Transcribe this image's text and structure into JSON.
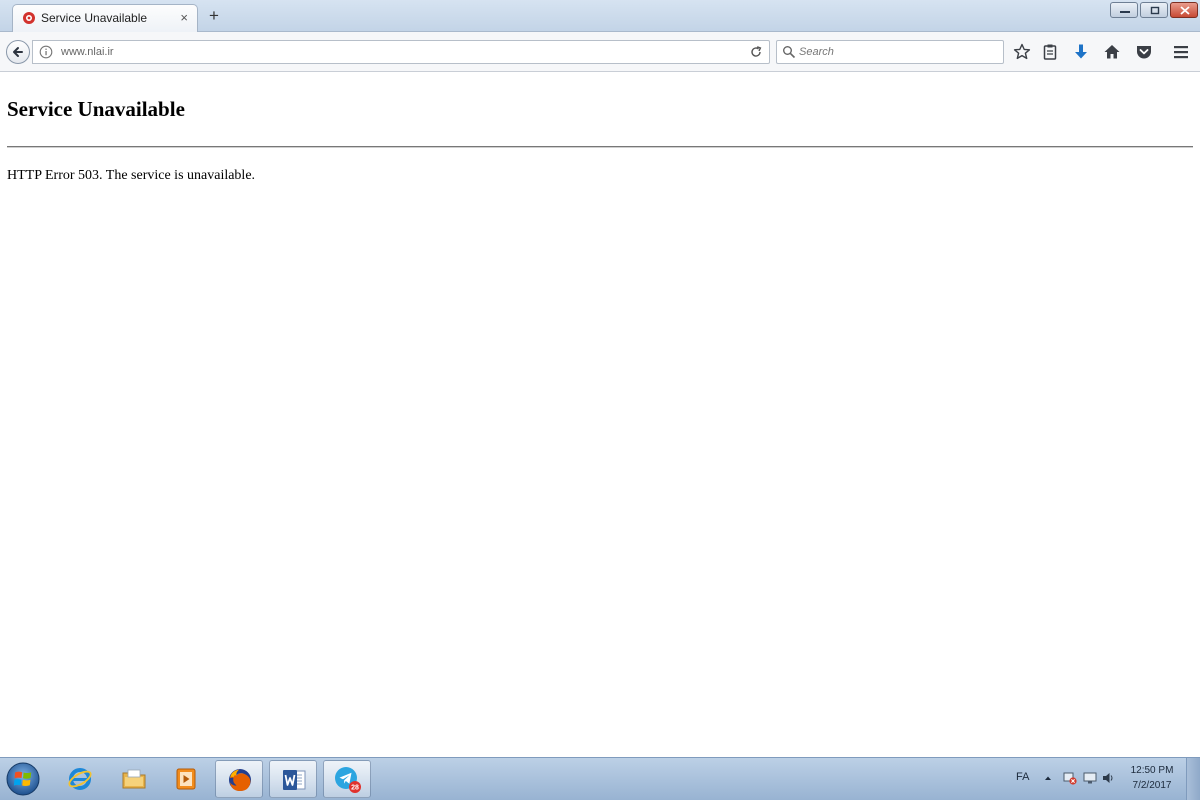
{
  "browser": {
    "tab": {
      "title": "Service Unavailable",
      "close_glyph": "×"
    },
    "new_tab_glyph": "+",
    "address_bar": {
      "url": "www.nlai.ir"
    },
    "search": {
      "placeholder": "Search"
    },
    "toolbar_icons": [
      "bookmark-star-icon",
      "library-clipboard-icon",
      "download-arrow-icon",
      "home-icon",
      "pocket-icon",
      "hamburger-menu-icon"
    ],
    "colors": {
      "download_icon": "#1e73c7",
      "tab_favicon": "#d2322d"
    }
  },
  "page": {
    "heading": "Service Unavailable",
    "message": "HTTP Error 503. The service is unavailable."
  },
  "taskbar": {
    "apps": [
      "windows-start-icon",
      "internet-explorer-icon",
      "file-explorer-icon",
      "media-player-icon",
      "firefox-icon",
      "word-icon",
      "telegram-icon"
    ],
    "telegram_badge": "28",
    "tray": {
      "language": "FA"
    },
    "clock": {
      "time": "12:50 PM",
      "date": "7/2/2017"
    }
  }
}
